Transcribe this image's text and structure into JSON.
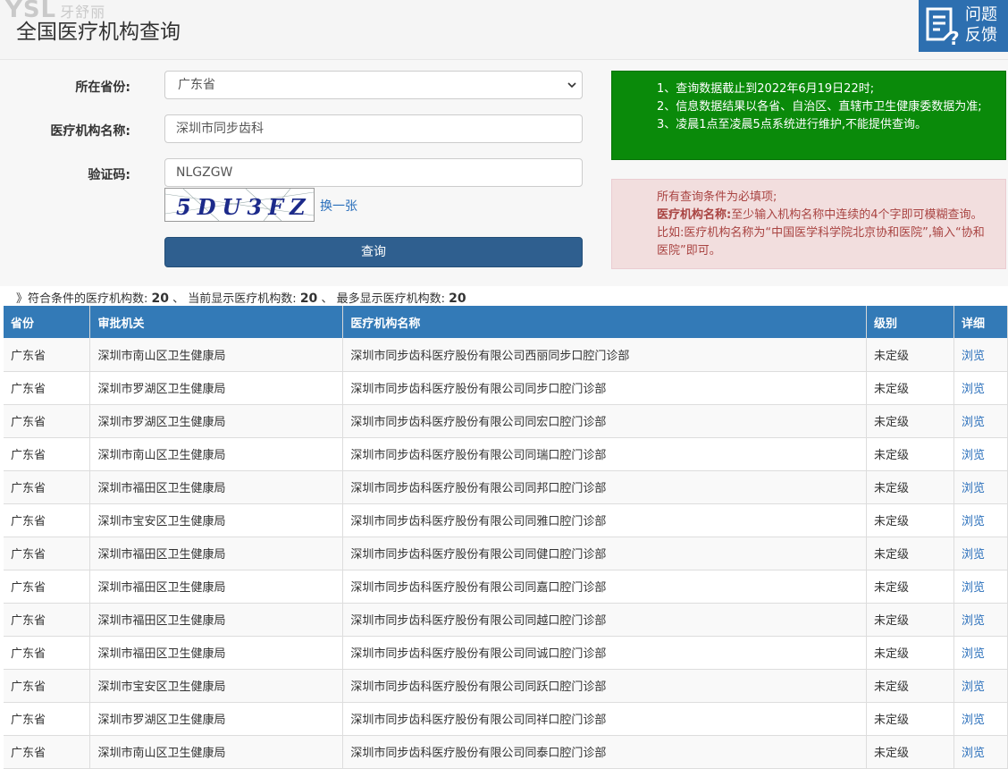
{
  "watermark": {
    "mark": "YSL",
    "text": "牙舒丽"
  },
  "header": {
    "title": "全国医疗机构查询"
  },
  "feedback": {
    "line1": "问题",
    "line2": "反馈",
    "icon": "feedback-icon"
  },
  "form": {
    "province_label": "所在省份:",
    "province_value": "广东省",
    "name_label": "医疗机构名称:",
    "name_value": "深圳市同步齿科",
    "captcha_label": "验证码:",
    "captcha_value": "NLGZGW",
    "captcha_text": "5DU3FZ",
    "refresh_label": "换一张",
    "submit_label": "查询"
  },
  "notice": {
    "green_lines": [
      "1、查询数据截止到2022年6月19日22时;",
      "2、信息数据结果以各省、自治区、直辖市卫生健康委数据为准;",
      "3、凌晨1点至凌晨5点系统进行维护,不能提供查询。"
    ],
    "red_line1": "所有查询条件为必填项;",
    "red_bold": "医疗机构名称:",
    "red_rest": "至少输入机构名称中连续的4个字即可模糊查询。比如:医疗机构名称为“中国医学科学院北京协和医院”,输入“协和医院”即可。"
  },
  "summary": {
    "prefix": "》符合条件的医疗机构数:",
    "matched": "20",
    "sep1": "、 当前显示医疗机构数:",
    "shown": "20",
    "sep2": "、 最多显示医疗机构数:",
    "max": "20"
  },
  "table": {
    "headers": [
      "省份",
      "审批机关",
      "医疗机构名称",
      "级别",
      "详细"
    ],
    "rows": [
      [
        "广东省",
        "深圳市南山区卫生健康局",
        "深圳市同步齿科医疗股份有限公司西丽同步口腔门诊部",
        "未定级",
        "浏览"
      ],
      [
        "广东省",
        "深圳市罗湖区卫生健康局",
        "深圳市同步齿科医疗股份有限公司同步口腔门诊部",
        "未定级",
        "浏览"
      ],
      [
        "广东省",
        "深圳市罗湖区卫生健康局",
        "深圳市同步齿科医疗股份有限公司同宏口腔门诊部",
        "未定级",
        "浏览"
      ],
      [
        "广东省",
        "深圳市南山区卫生健康局",
        "深圳市同步齿科医疗股份有限公司同瑞口腔门诊部",
        "未定级",
        "浏览"
      ],
      [
        "广东省",
        "深圳市福田区卫生健康局",
        "深圳市同步齿科医疗股份有限公司同邦口腔门诊部",
        "未定级",
        "浏览"
      ],
      [
        "广东省",
        "深圳市宝安区卫生健康局",
        "深圳市同步齿科医疗股份有限公司同雅口腔门诊部",
        "未定级",
        "浏览"
      ],
      [
        "广东省",
        "深圳市福田区卫生健康局",
        "深圳市同步齿科医疗股份有限公司同健口腔门诊部",
        "未定级",
        "浏览"
      ],
      [
        "广东省",
        "深圳市福田区卫生健康局",
        "深圳市同步齿科医疗股份有限公司同嘉口腔门诊部",
        "未定级",
        "浏览"
      ],
      [
        "广东省",
        "深圳市福田区卫生健康局",
        "深圳市同步齿科医疗股份有限公司同越口腔门诊部",
        "未定级",
        "浏览"
      ],
      [
        "广东省",
        "深圳市福田区卫生健康局",
        "深圳市同步齿科医疗股份有限公司同诚口腔门诊部",
        "未定级",
        "浏览"
      ],
      [
        "广东省",
        "深圳市宝安区卫生健康局",
        "深圳市同步齿科医疗股份有限公司同跃口腔门诊部",
        "未定级",
        "浏览"
      ],
      [
        "广东省",
        "深圳市罗湖区卫生健康局",
        "深圳市同步齿科医疗股份有限公司同祥口腔门诊部",
        "未定级",
        "浏览"
      ],
      [
        "广东省",
        "深圳市南山区卫生健康局",
        "深圳市同步齿科医疗股份有限公司同泰口腔门诊部",
        "未定级",
        "浏览"
      ]
    ]
  },
  "colors": {
    "header_blue": "#337ab7",
    "button": "#2f5f8f",
    "notice_green": "#0a8a0a",
    "notice_red_bg": "#f2dede",
    "link": "#2a6fbb"
  }
}
